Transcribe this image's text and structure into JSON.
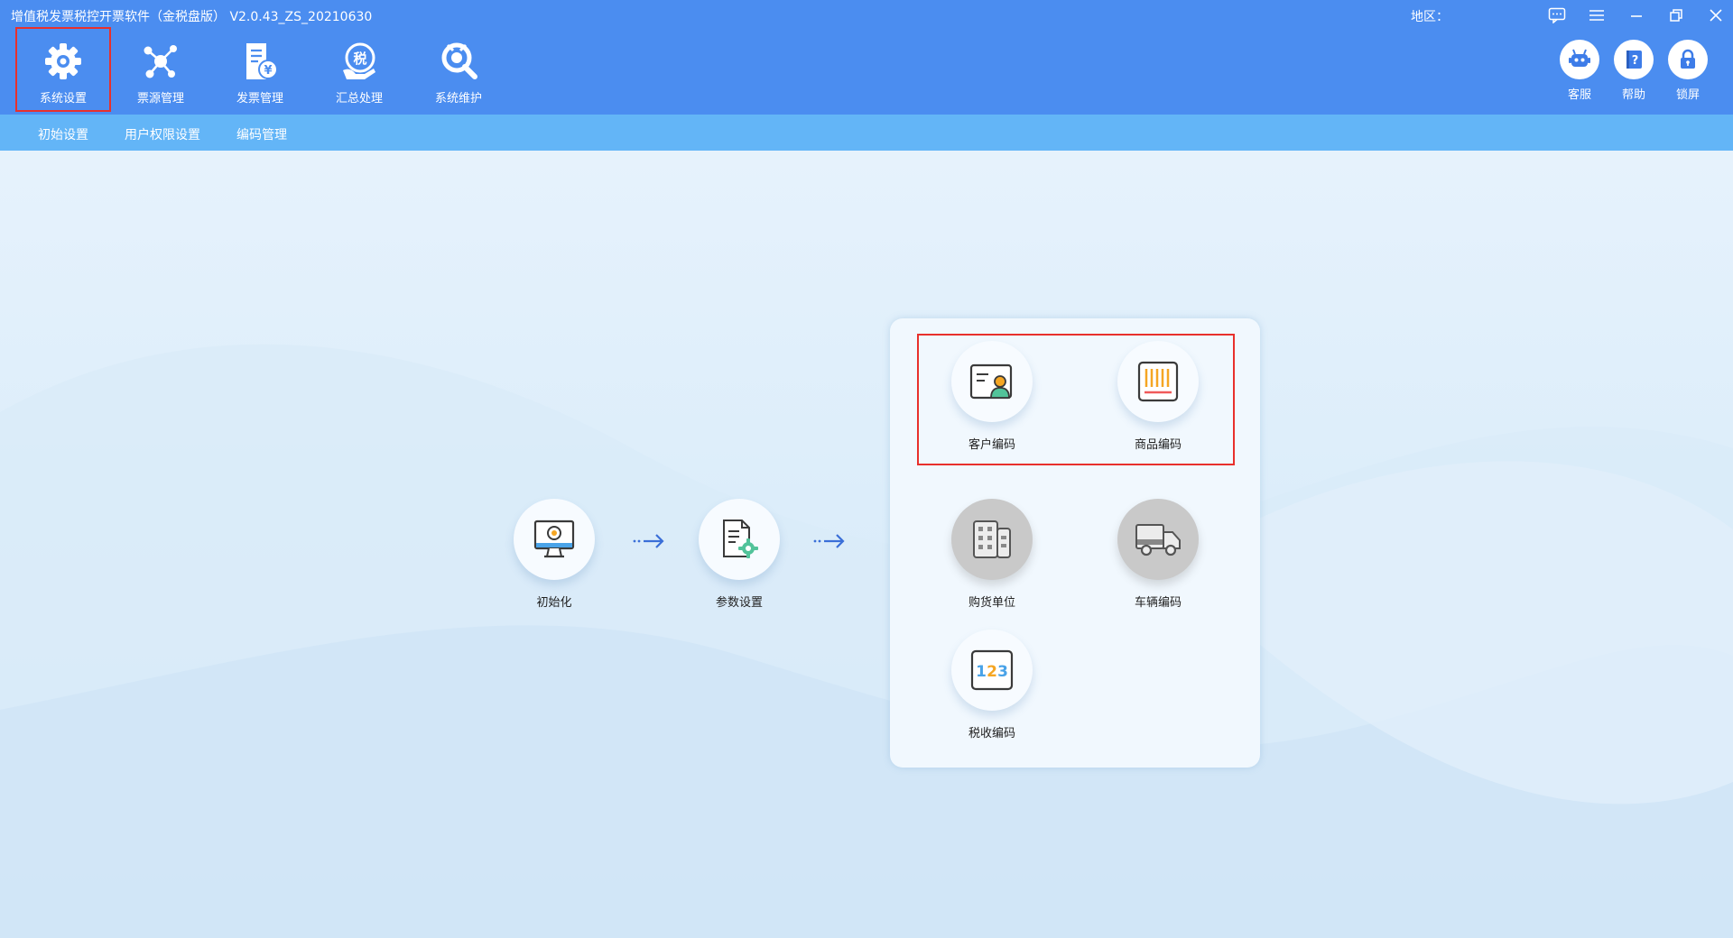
{
  "window": {
    "title": "增值税发票税控开票软件（金税盘版） V2.0.43_ZS_20210630",
    "region_label": "地区：",
    "controls": [
      "message-icon",
      "menu-icon",
      "minimize-icon",
      "restore-icon",
      "close-icon"
    ]
  },
  "top_tabs": [
    {
      "label": "系统设置",
      "icon": "gear-icon",
      "active": true
    },
    {
      "label": "票源管理",
      "icon": "network-icon",
      "active": false
    },
    {
      "label": "发票管理",
      "icon": "invoice-icon",
      "active": false
    },
    {
      "label": "汇总处理",
      "icon": "tax-summary-icon",
      "active": false
    },
    {
      "label": "系统维护",
      "icon": "maintenance-icon",
      "active": false
    }
  ],
  "right_buttons": [
    {
      "label": "客服",
      "icon": "robot-icon"
    },
    {
      "label": "帮助",
      "icon": "help-book-icon"
    },
    {
      "label": "锁屏",
      "icon": "lock-icon"
    }
  ],
  "sub_nav": [
    "初始设置",
    "用户权限设置",
    "编码管理"
  ],
  "flow": {
    "steps": [
      {
        "label": "初始化",
        "icon": "monitor-icon"
      },
      {
        "label": "参数设置",
        "icon": "document-settings-icon"
      }
    ],
    "coding_items": [
      {
        "label": "客户编码",
        "icon": "customer-card-icon",
        "enabled": true
      },
      {
        "label": "商品编码",
        "icon": "barcode-icon",
        "enabled": true
      },
      {
        "label": "购货单位",
        "icon": "building-icon",
        "enabled": false
      },
      {
        "label": "车辆编码",
        "icon": "truck-icon",
        "enabled": false
      },
      {
        "label": "税收编码",
        "icon": "number-code-icon",
        "enabled": true
      }
    ],
    "tax_code_digits": [
      "1",
      "2",
      "3"
    ]
  },
  "colors": {
    "header": "#4b8df0",
    "subnav": "#63b5f7",
    "highlight": "#e8302c",
    "arrow": "#3a6fd8"
  }
}
